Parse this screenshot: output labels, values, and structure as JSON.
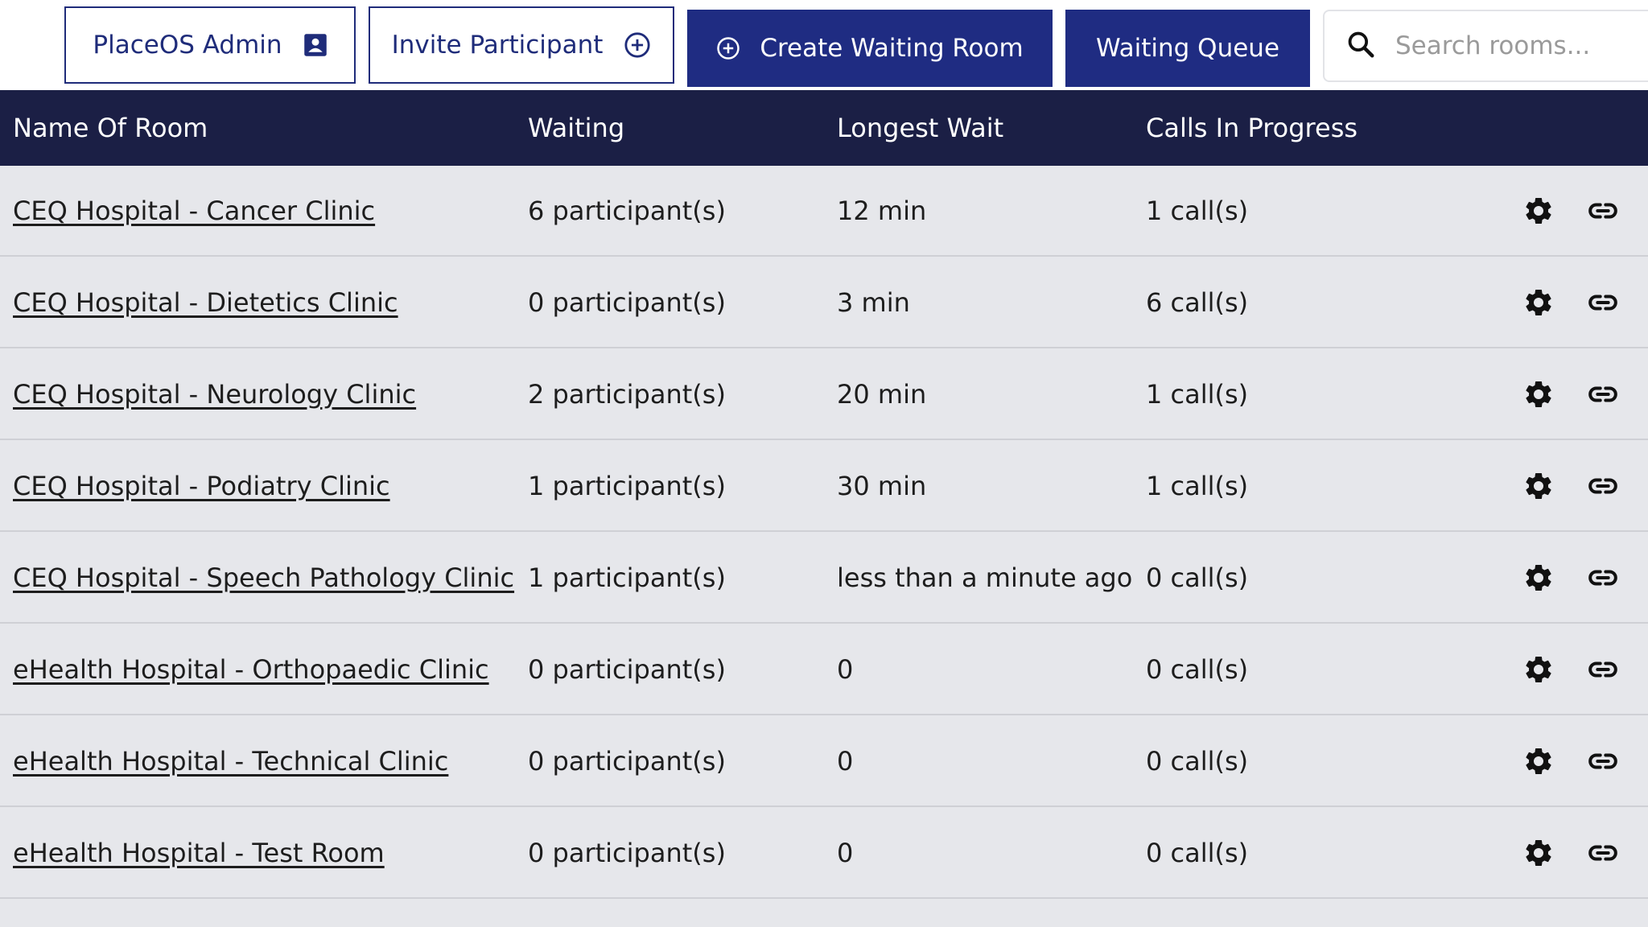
{
  "toolbar": {
    "admin_label": "PlaceOS Admin",
    "admin_icon": "contact-card-icon",
    "invite_label": "Invite Participant",
    "invite_icon": "plus-circle-icon",
    "create_label": "Create Waiting Room",
    "create_icon": "plus-circle-icon",
    "queue_label": "Waiting Queue",
    "search_placeholder": "Search rooms...",
    "search_icon": "search-icon"
  },
  "table": {
    "headers": [
      "Name Of Room",
      "Waiting",
      "Longest Wait",
      "Calls In Progress"
    ],
    "row_actions": [
      "gear-icon",
      "link-icon"
    ],
    "rows": [
      {
        "name": "CEQ Hospital - Cancer Clinic",
        "waiting": "6 participant(s)",
        "longest": "12 min",
        "calls": "1 call(s)"
      },
      {
        "name": "CEQ Hospital - Dietetics Clinic",
        "waiting": "0 participant(s)",
        "longest": "3 min",
        "calls": "6 call(s)"
      },
      {
        "name": "CEQ Hospital - Neurology Clinic",
        "waiting": "2 participant(s)",
        "longest": "20 min",
        "calls": "1 call(s)"
      },
      {
        "name": "CEQ Hospital - Podiatry Clinic",
        "waiting": "1 participant(s)",
        "longest": "30 min",
        "calls": "1 call(s)"
      },
      {
        "name": "CEQ Hospital - Speech Pathology Clinic",
        "waiting": "1 participant(s)",
        "longest": "less than a minute ago",
        "calls": "0 call(s)"
      },
      {
        "name": "eHealth Hospital - Orthopaedic Clinic",
        "waiting": "0 participant(s)",
        "longest": "0",
        "calls": "0 call(s)"
      },
      {
        "name": "eHealth Hospital - Technical Clinic",
        "waiting": "0 participant(s)",
        "longest": "0",
        "calls": "0 call(s)"
      },
      {
        "name": "eHealth Hospital - Test Room",
        "waiting": "0 participant(s)",
        "longest": "0",
        "calls": "0 call(s)"
      }
    ]
  },
  "colors": {
    "primary": "#1f2c82",
    "header_bg": "#1b1f45",
    "row_bg": "#e6e7eb"
  }
}
